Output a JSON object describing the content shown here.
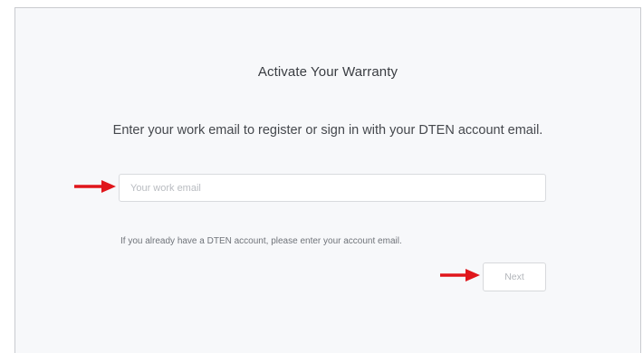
{
  "panel": {
    "title": "Activate Your Warranty",
    "subtitle": "Enter your work email to register or sign in with your DTEN account email."
  },
  "email_field": {
    "placeholder": "Your work email",
    "value": ""
  },
  "hint": "If you already have a DTEN account, please enter your account email.",
  "next_button": {
    "label": "Next"
  },
  "annotations": {
    "arrow_color": "#e0161b",
    "icons": [
      "arrow-right-icon",
      "arrow-right-icon"
    ]
  },
  "colors": {
    "panel_background": "#f7f8fa",
    "panel_border": "#c9cbcf",
    "text_primary": "#3a3d42",
    "placeholder": "#b9bcc1",
    "button_text": "#b3b6bb"
  }
}
